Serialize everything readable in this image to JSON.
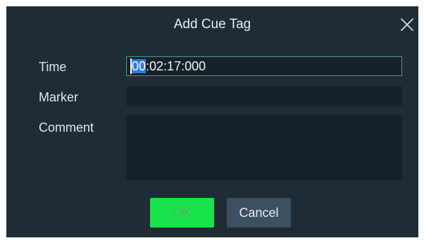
{
  "dialog": {
    "title": "Add Cue Tag",
    "close_icon": "close-icon"
  },
  "form": {
    "time_label": "Time",
    "time_value_selected": "00",
    "time_value_rest": ":02:17:000",
    "marker_label": "Marker",
    "marker_value": "",
    "comment_label": "Comment",
    "comment_value": ""
  },
  "buttons": {
    "ok_label": "OK",
    "cancel_label": "Cancel"
  },
  "colors": {
    "dialog_bg": "#1f2c35",
    "field_bg": "#162229",
    "focus_border": "#4a9a8c",
    "selection": "#2e7bd6",
    "ok_bg": "#19e34a",
    "cancel_bg": "#3b5060"
  }
}
